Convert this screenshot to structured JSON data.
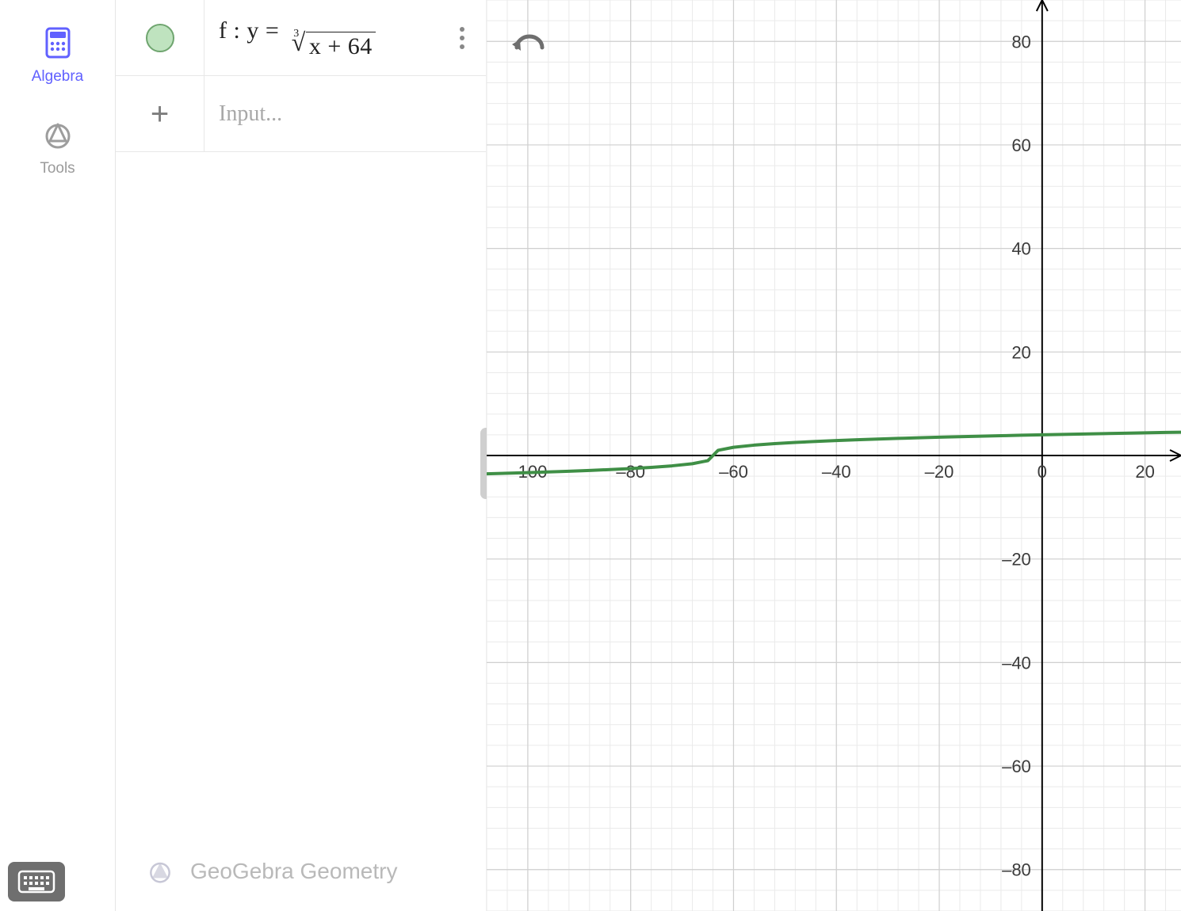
{
  "sidebar": {
    "tabs": [
      {
        "id": "algebra",
        "label": "Algebra",
        "active": true
      },
      {
        "id": "tools",
        "label": "Tools",
        "active": false
      }
    ]
  },
  "algebra_panel": {
    "rows": [
      {
        "kind": "equation",
        "visibility_color": "#bfe3bf",
        "prefix": "f :  y =",
        "root_index": "3",
        "radicand": "x + 64"
      },
      {
        "kind": "input",
        "placeholder": "Input..."
      }
    ],
    "brand": "GeoGebra Geometry"
  },
  "graph_toolbar": {
    "undo": "undo"
  },
  "chart_data": {
    "type": "line",
    "title": "",
    "xlabel": "",
    "ylabel": "",
    "xlim": [
      -108,
      27
    ],
    "ylim": [
      -88,
      88
    ],
    "x_ticks": [
      -100,
      -80,
      -60,
      -40,
      -20,
      0,
      20
    ],
    "y_ticks": [
      -80,
      -60,
      -40,
      -20,
      20,
      40,
      60,
      80
    ],
    "minor_grid_step": 4,
    "major_grid_step": 20,
    "series": [
      {
        "name": "f",
        "color": "#3f8f46",
        "expression": "y = cbrt(x + 64)",
        "x": [
          -108,
          -104,
          -100,
          -96,
          -92,
          -88,
          -84,
          -80,
          -76,
          -72,
          -68,
          -65,
          -64,
          -63,
          -60,
          -56,
          -52,
          -48,
          -44,
          -40,
          -36,
          -32,
          -28,
          -24,
          -20,
          -16,
          -12,
          -8,
          -4,
          0,
          4,
          8,
          12,
          16,
          20,
          24,
          27
        ],
        "values": [
          -3.53,
          -3.42,
          -3.302,
          -3.175,
          -3.037,
          -2.884,
          -2.714,
          -2.52,
          -2.289,
          -2.0,
          -1.587,
          -1.0,
          0.0,
          1.0,
          1.587,
          2.0,
          2.289,
          2.52,
          2.714,
          2.884,
          3.037,
          3.175,
          3.302,
          3.42,
          3.53,
          3.634,
          3.733,
          3.826,
          3.915,
          4.0,
          4.082,
          4.16,
          4.236,
          4.309,
          4.38,
          4.448,
          4.498
        ]
      }
    ]
  }
}
